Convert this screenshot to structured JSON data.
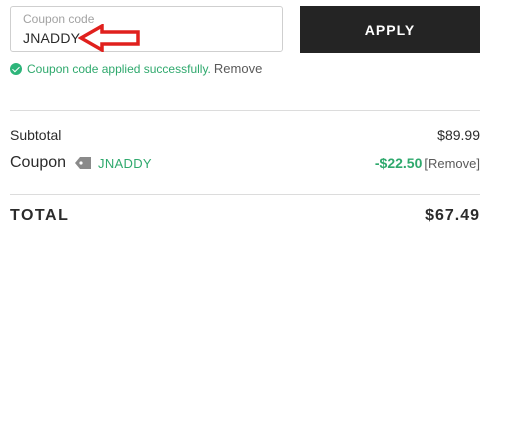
{
  "coupon_field": {
    "label": "Coupon code",
    "value": "JNADDY"
  },
  "apply_button": {
    "label": "APPLY"
  },
  "status": {
    "message": "Coupon code applied successfully.",
    "remove_label": "Remove"
  },
  "summary": {
    "subtotal_label": "Subtotal",
    "subtotal_value": "$89.99",
    "coupon_label": "Coupon",
    "coupon_code": "JNADDY",
    "discount": "-$22.50",
    "remove_label": "[Remove]",
    "total_label": "TOTAL",
    "total_value": "$67.49"
  },
  "colors": {
    "success_green": "#2fa96d",
    "button_dark": "#242424",
    "arrow_red": "#e0201d"
  },
  "icons": {
    "status": "check-circle-icon",
    "coupon_tag": "tag-icon",
    "annotation": "red-arrow-icon"
  }
}
